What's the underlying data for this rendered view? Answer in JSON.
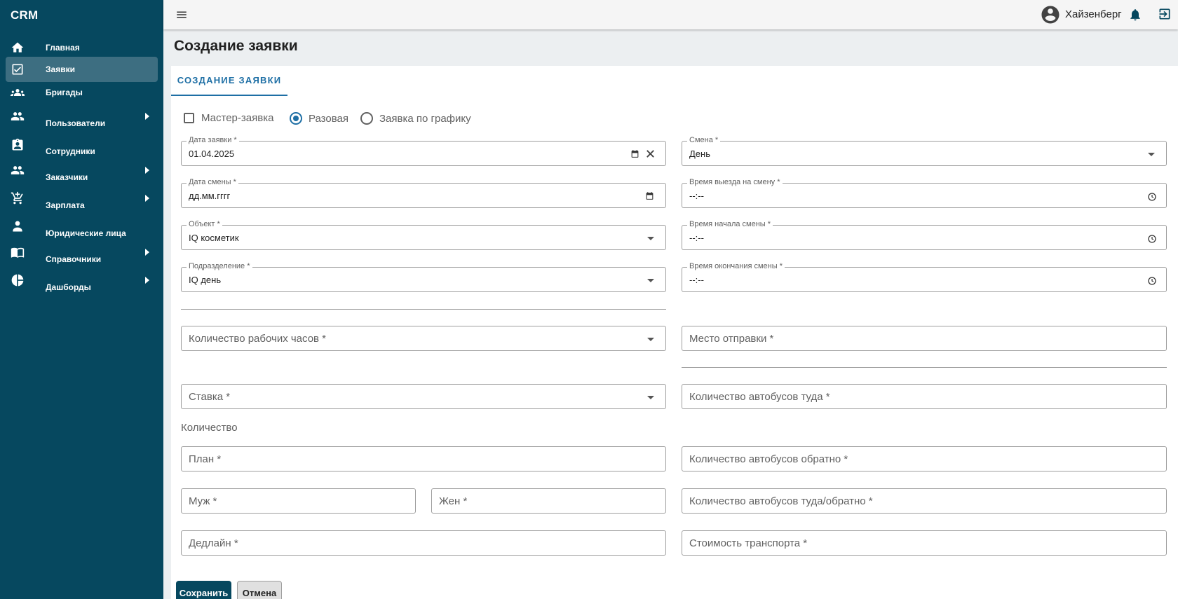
{
  "app": {
    "brand": "CRM"
  },
  "sidebar": {
    "items": [
      {
        "label": "Главная",
        "icon": "home-icon"
      },
      {
        "label": "Заявки",
        "icon": "checkbox-icon",
        "active": true
      },
      {
        "label": "Бригады",
        "icon": "group-icon"
      },
      {
        "label": "Пользователи",
        "icon": "people-icon",
        "expandable": true
      },
      {
        "label": "Сотрудники",
        "icon": "badge-icon"
      },
      {
        "label": "Заказчики",
        "icon": "people-icon",
        "expandable": true
      },
      {
        "label": "Зарплата",
        "icon": "cart-icon",
        "expandable": true
      },
      {
        "label": "Юридические лица",
        "icon": "person-icon"
      },
      {
        "label": "Справочники",
        "icon": "book-icon",
        "expandable": true
      },
      {
        "label": "Дашборды",
        "icon": "pie-chart-icon",
        "expandable": true
      }
    ]
  },
  "header": {
    "user_name": "Хайзенберг"
  },
  "page": {
    "title": "Создание заявки",
    "tab": "СОЗДАНИЕ ЗАЯВКИ"
  },
  "form": {
    "type_options": {
      "master": {
        "label": "Мастер-заявка",
        "checked": false
      },
      "single": {
        "label": "Разовая",
        "selected": true
      },
      "scheduled": {
        "label": "Заявка по графику",
        "selected": false
      }
    },
    "date": {
      "label": "Дата заявки *",
      "value": "01.04.2025"
    },
    "shift": {
      "label": "Смена *",
      "value": "День"
    },
    "shift_date": {
      "label": "Дата смены *",
      "value": "дд.мм.гггг"
    },
    "departure_time": {
      "label": "Время выезда на смену *",
      "value": "--:--"
    },
    "object": {
      "label": "Объект *",
      "value": "IQ косметик"
    },
    "start_time": {
      "label": "Время начала смены *",
      "value": "--:--"
    },
    "division": {
      "label": "Подразделение *",
      "value": "IQ день"
    },
    "end_time": {
      "label": "Время окончания смены *",
      "value": "--:--"
    },
    "work_hours": {
      "placeholder": "Количество рабочих часов *"
    },
    "departure_place": {
      "placeholder": "Место отправки *"
    },
    "rate": {
      "placeholder": "Ставка *"
    },
    "buses_there": {
      "placeholder": "Количество автобусов туда *"
    },
    "quantity_section": "Количество",
    "plan": {
      "placeholder": "План *"
    },
    "buses_back": {
      "placeholder": "Количество автобусов обратно *"
    },
    "male": {
      "placeholder": "Муж *"
    },
    "female": {
      "placeholder": "Жен *"
    },
    "buses_both": {
      "placeholder": "Количество автобусов туда/обратно *"
    },
    "deadline": {
      "placeholder": "Дедлайн *"
    },
    "transport_cost": {
      "placeholder": "Стоимость транспорта *"
    }
  },
  "actions": {
    "save": "Сохранить",
    "cancel": "Отмена"
  },
  "colors": {
    "sidebar": "#06485f",
    "active_item": "#3d6e81",
    "accent": "#1e6fa5"
  }
}
